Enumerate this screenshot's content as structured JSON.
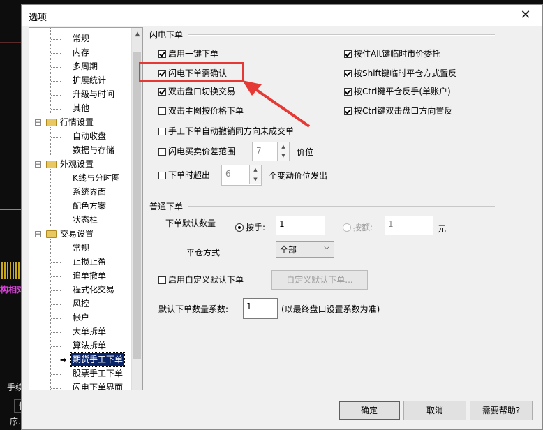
{
  "background": {
    "text_fee": "手续",
    "text_kuai": "快",
    "text_xu": "序.",
    "text_pink": "构相对"
  },
  "dialog": {
    "title": "选项",
    "close_glyph": "✕"
  },
  "tree": {
    "items": [
      {
        "label": "常规"
      },
      {
        "label": "内存"
      },
      {
        "label": "多周期"
      },
      {
        "label": "扩展统计"
      },
      {
        "label": "升级与时间"
      },
      {
        "label": "其他"
      },
      {
        "label": "行情设置"
      },
      {
        "label": "自动收盘"
      },
      {
        "label": "数据与存储"
      },
      {
        "label": "外观设置"
      },
      {
        "label": "K线与分时图"
      },
      {
        "label": "系统界面"
      },
      {
        "label": "配色方案"
      },
      {
        "label": "状态栏"
      },
      {
        "label": "交易设置"
      },
      {
        "label": "常规"
      },
      {
        "label": "止损止盈"
      },
      {
        "label": "追单撤单"
      },
      {
        "label": "程式化交易"
      },
      {
        "label": "风控"
      },
      {
        "label": "帐户"
      },
      {
        "label": "大单拆单"
      },
      {
        "label": "算法拆单"
      },
      {
        "label": "期货手工下单"
      },
      {
        "label": "股票手工下单"
      },
      {
        "label": "闪电下单界面"
      }
    ],
    "expander_glyph": "−",
    "arrow_glyph": "➡"
  },
  "flash": {
    "group_title": "闪电下单",
    "cb_one_click": "启用一键下单",
    "cb_confirm": "闪电下单需确认",
    "cb_dblclick_switch": "双击盘口切换交易",
    "cb_dblclick_chart": "双击主图按价格下单",
    "cb_manual_cancel": "手工下单自动撤销同方向未成交单",
    "cb_spread": "闪电买卖价差范围",
    "spread_value": "7",
    "spread_unit": "价位",
    "cb_timeout": "下单时超出",
    "timeout_value": "6",
    "timeout_unit": "个变动价位发出",
    "cb_alt": "按住Alt键临时市价委托",
    "cb_shift": "按Shift键临时平仓方式置反",
    "cb_ctrl": "按Ctrl键平仓反手(单账户)",
    "cb_ctrl_dbl": "按Ctrl键双击盘口方向置反"
  },
  "normal": {
    "group_title": "普通下单",
    "default_qty_label": "下单默认数量",
    "radio_by_hand": "按手:",
    "hand_value": "1",
    "radio_by_amount": "按额:",
    "amount_value": "1",
    "amount_unit": "元",
    "close_mode_label": "平仓方式",
    "close_mode_value": "全部",
    "cb_custom_default": "启用自定义默认下单",
    "custom_default_button": "自定义默认下单...",
    "coef_label": "默认下单数量系数:",
    "coef_value": "1",
    "coef_note": "(以最终盘口设置系数为准)"
  },
  "footer": {
    "ok": "确定",
    "cancel": "取消",
    "help": "需要帮助?"
  },
  "colors": {
    "highlight": "#e53935",
    "selection": "#0a246a"
  }
}
